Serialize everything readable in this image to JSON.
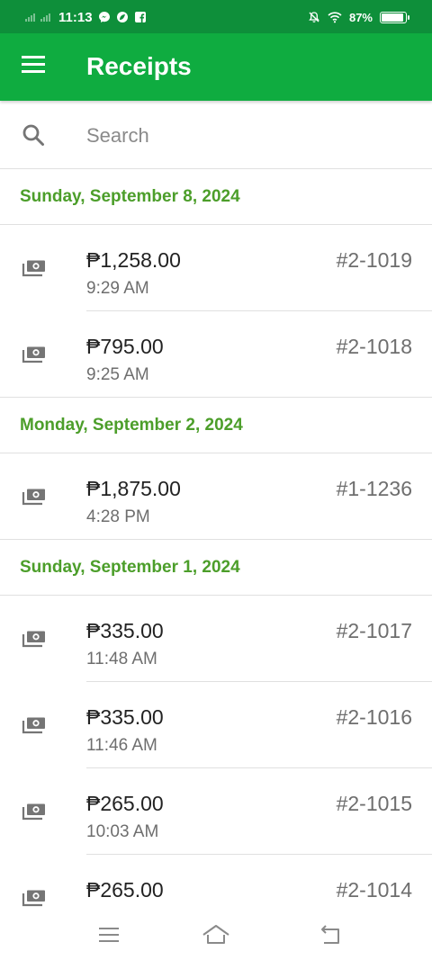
{
  "status_bar": {
    "time": "11:13",
    "battery_percent": "87%",
    "battery_level": 0.87,
    "icons": [
      "signal-icon",
      "messenger-icon",
      "leaf-icon",
      "facebook-icon",
      "mute-icon",
      "wifi-icon",
      "battery-icon"
    ]
  },
  "app_bar": {
    "title": "Receipts",
    "menu_icon": "menu-icon",
    "background": "#0fac40"
  },
  "search": {
    "placeholder": "Search",
    "value": "",
    "icon": "search-icon"
  },
  "groups": [
    {
      "date": "Sunday, September 8, 2024",
      "receipts": [
        {
          "amount": "₱1,258.00",
          "time": "9:29 AM",
          "number": "#2-1019",
          "icon": "cash-icon"
        },
        {
          "amount": "₱795.00",
          "time": "9:25 AM",
          "number": "#2-1018",
          "icon": "cash-icon"
        }
      ]
    },
    {
      "date": "Monday, September 2, 2024",
      "receipts": [
        {
          "amount": "₱1,875.00",
          "time": "4:28 PM",
          "number": "#1-1236",
          "icon": "cash-icon"
        }
      ]
    },
    {
      "date": "Sunday, September 1, 2024",
      "receipts": [
        {
          "amount": "₱335.00",
          "time": "11:48 AM",
          "number": "#2-1017",
          "icon": "cash-icon"
        },
        {
          "amount": "₱335.00",
          "time": "11:46 AM",
          "number": "#2-1016",
          "icon": "cash-icon"
        },
        {
          "amount": "₱265.00",
          "time": "10:03 AM",
          "number": "#2-1015",
          "icon": "cash-icon"
        },
        {
          "amount": "₱265.00",
          "time": "",
          "number": "#2-1014",
          "icon": "cash-icon"
        }
      ]
    }
  ],
  "colors": {
    "accent_green": "#0fac40",
    "date_header_green": "#4c9e2a"
  },
  "nav_bar": {
    "icons": [
      "recents-icon",
      "home-icon",
      "back-icon"
    ]
  }
}
